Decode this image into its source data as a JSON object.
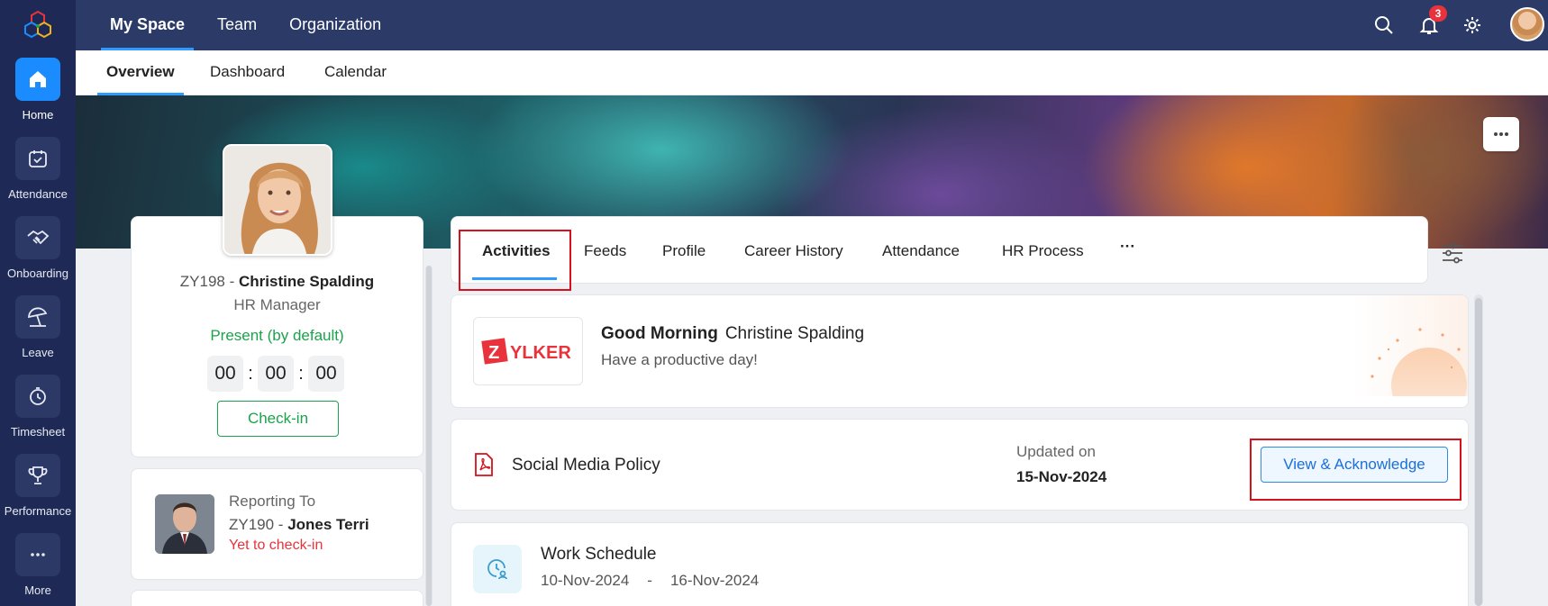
{
  "rail": {
    "items": [
      {
        "label": "Home",
        "icon": "home-icon",
        "active": true
      },
      {
        "label": "Attendance",
        "icon": "calendar-check-icon"
      },
      {
        "label": "Onboarding",
        "icon": "handshake-icon"
      },
      {
        "label": "Leave",
        "icon": "beach-umbrella-icon"
      },
      {
        "label": "Timesheet",
        "icon": "stopwatch-icon"
      },
      {
        "label": "Performance",
        "icon": "trophy-icon"
      },
      {
        "label": "More",
        "icon": "more-dots-icon"
      }
    ]
  },
  "topnav": {
    "tabs": [
      {
        "label": "My Space",
        "active": true
      },
      {
        "label": "Team"
      },
      {
        "label": "Organization"
      }
    ],
    "notification_count": "3"
  },
  "subnav": {
    "tabs": [
      {
        "label": "Overview",
        "active": true
      },
      {
        "label": "Dashboard"
      },
      {
        "label": "Calendar"
      }
    ]
  },
  "profile": {
    "emp_id": "ZY198 - ",
    "name": "Christine Spalding",
    "role": "HR Manager",
    "status": "Present (by default)",
    "timer": {
      "hh": "00",
      "mm": "00",
      "ss": "00",
      "sep": ":"
    },
    "checkin_label": "Check-in"
  },
  "reporting": {
    "title": "Reporting To",
    "emp_id": "ZY190 - ",
    "name": "Jones Terri",
    "status": "Yet to check-in"
  },
  "tabs": {
    "items": [
      {
        "label": "Activities",
        "active": true
      },
      {
        "label": "Feeds"
      },
      {
        "label": "Profile"
      },
      {
        "label": "Career History"
      },
      {
        "label": "Attendance"
      },
      {
        "label": "HR Process"
      },
      {
        "label": "···"
      }
    ]
  },
  "greeting": {
    "logo_text": "ZYLKER",
    "title": "Good Morning",
    "name": "Christine Spalding",
    "subtitle": "Have a productive day!"
  },
  "policy": {
    "title": "Social Media Policy",
    "updated_label": "Updated on",
    "updated_date": "15-Nov-2024",
    "action_label": "View & Acknowledge"
  },
  "schedule": {
    "title": "Work Schedule",
    "start": "10-Nov-2024",
    "dash": "-",
    "end": "16-Nov-2024"
  },
  "colors": {
    "rail_bg": "#1e2a55",
    "topbar_bg": "#2b3a67",
    "accent": "#1a8cff",
    "present": "#1ba34b",
    "absent": "#e8333c",
    "highlight": "#d6111b"
  }
}
